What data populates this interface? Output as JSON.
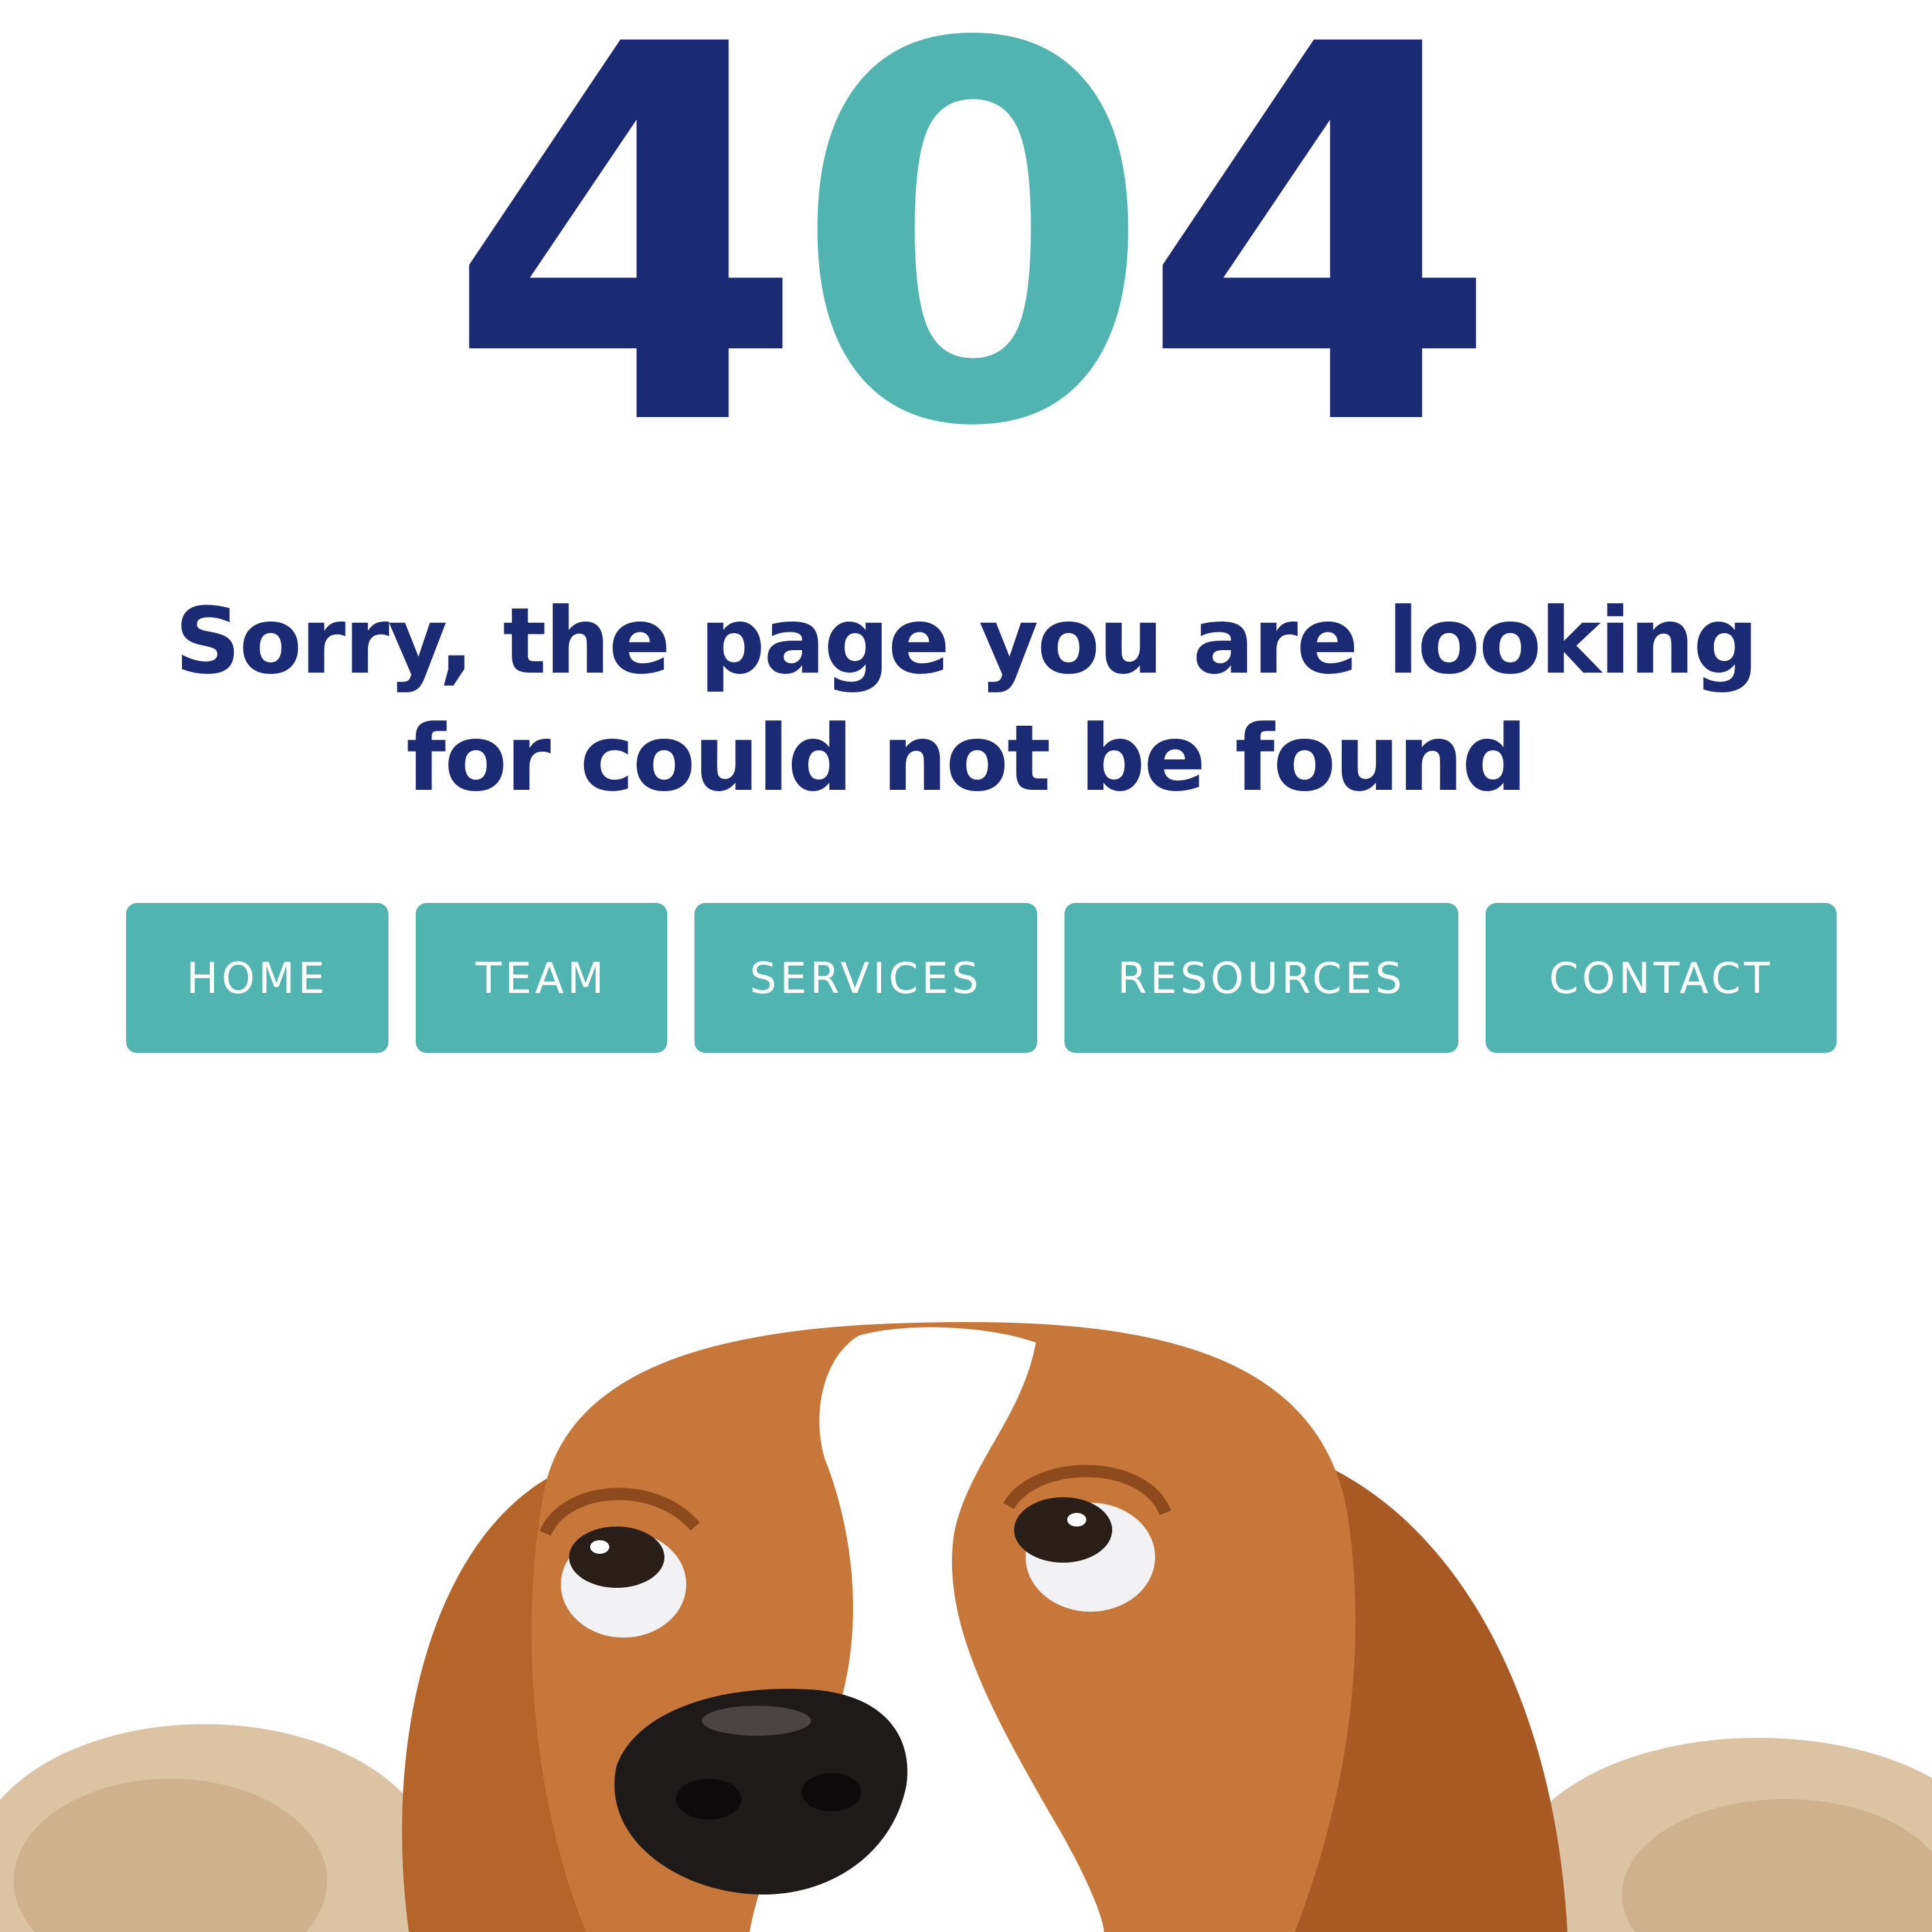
{
  "error": {
    "digits": [
      "4",
      "0",
      "4"
    ],
    "message_line_1": "Sorry, the page you are looking",
    "message_line_2": "for could not be found"
  },
  "nav": {
    "items": [
      {
        "label": "HOME"
      },
      {
        "label": "TEAM"
      },
      {
        "label": "SERVICES"
      },
      {
        "label": "RESOURCES"
      },
      {
        "label": "CONTACT"
      }
    ]
  },
  "colors": {
    "navy": "#1b2a73",
    "teal": "#52b4b0",
    "background": "#ffffff"
  },
  "image": {
    "subject": "beagle-puppy-looking-up"
  }
}
